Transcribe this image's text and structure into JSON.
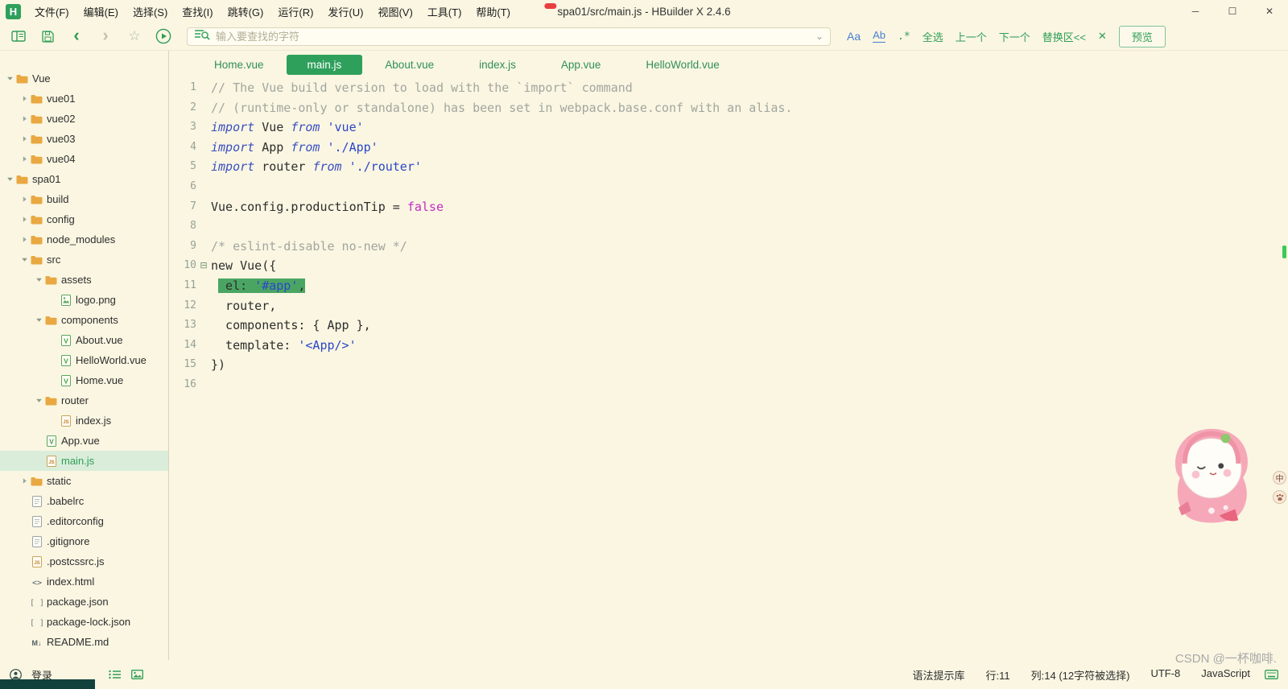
{
  "window": {
    "logo": "H",
    "title": "spa01/src/main.js - HBuilder X 2.4.6"
  },
  "menu": {
    "items": [
      "文件(F)",
      "编辑(E)",
      "选择(S)",
      "查找(I)",
      "跳转(G)",
      "运行(R)",
      "发行(U)",
      "视图(V)",
      "工具(T)",
      "帮助(T)"
    ]
  },
  "icons": {
    "minimize": "─",
    "maximize": "☐",
    "close": "✕",
    "back": "‹",
    "forward": "›",
    "star": "☆",
    "search_dropdown": "⌄",
    "match_case": "Aa",
    "whole_word": "Ab",
    "regex": ".*",
    "fold_collapse": "⊟",
    "ime": "中"
  },
  "colors": {
    "accent_green": "#2f9e57",
    "tab_active_bg": "#2fa05c",
    "selection_green": "#4aa563",
    "folder_yellow": "#e9a841",
    "badge_red": "#e84040",
    "scroll_marker": "#3ec957"
  },
  "toolbar": {
    "search_placeholder": "输入要查找的字符",
    "actions": [
      "全选",
      "上一个",
      "下一个",
      "替换区<<"
    ],
    "preview_label": "预览"
  },
  "sidebar": {
    "tree": [
      {
        "label": "Vue",
        "level": 0,
        "kind": "folder",
        "icon": "folder-icon",
        "state": "expanded"
      },
      {
        "label": "vue01",
        "level": 1,
        "kind": "folder",
        "icon": "folder-icon",
        "state": "collapsed"
      },
      {
        "label": "vue02",
        "level": 1,
        "kind": "folder",
        "icon": "folder-icon",
        "state": "collapsed"
      },
      {
        "label": "vue03",
        "level": 1,
        "kind": "folder",
        "icon": "folder-icon",
        "state": "collapsed"
      },
      {
        "label": "vue04",
        "level": 1,
        "kind": "folder",
        "icon": "folder-icon",
        "state": "collapsed"
      },
      {
        "label": "spa01",
        "level": 0,
        "kind": "folder",
        "icon": "folder-icon",
        "state": "expanded"
      },
      {
        "label": "build",
        "level": 1,
        "kind": "folder",
        "icon": "folder-icon",
        "state": "collapsed"
      },
      {
        "label": "config",
        "level": 1,
        "kind": "folder",
        "icon": "folder-icon",
        "state": "collapsed"
      },
      {
        "label": "node_modules",
        "level": 1,
        "kind": "folder",
        "icon": "folder-icon",
        "state": "collapsed"
      },
      {
        "label": "src",
        "level": 1,
        "kind": "folder",
        "icon": "folder-icon",
        "state": "expanded"
      },
      {
        "label": "assets",
        "level": 2,
        "kind": "folder",
        "icon": "folder-icon",
        "state": "expanded"
      },
      {
        "label": "logo.png",
        "level": 3,
        "kind": "file",
        "icon": "image-file-icon"
      },
      {
        "label": "components",
        "level": 2,
        "kind": "folder",
        "icon": "folder-icon",
        "state": "expanded"
      },
      {
        "label": "About.vue",
        "level": 3,
        "kind": "file",
        "icon": "vue-file-icon"
      },
      {
        "label": "HelloWorld.vue",
        "level": 3,
        "kind": "file",
        "icon": "vue-file-icon"
      },
      {
        "label": "Home.vue",
        "level": 3,
        "kind": "file",
        "icon": "vue-file-icon"
      },
      {
        "label": "router",
        "level": 2,
        "kind": "folder",
        "icon": "folder-icon",
        "state": "expanded"
      },
      {
        "label": "index.js",
        "level": 3,
        "kind": "file",
        "icon": "js-file-icon"
      },
      {
        "label": "App.vue",
        "level": 2,
        "kind": "file",
        "icon": "vue-file-icon"
      },
      {
        "label": "main.js",
        "level": 2,
        "kind": "file",
        "icon": "js-file-icon",
        "selected": true
      },
      {
        "label": "static",
        "level": 1,
        "kind": "folder",
        "icon": "folder-icon",
        "state": "collapsed"
      },
      {
        "label": ".babelrc",
        "level": 1,
        "kind": "file",
        "icon": "plain-file-icon"
      },
      {
        "label": ".editorconfig",
        "level": 1,
        "kind": "file",
        "icon": "plain-file-icon"
      },
      {
        "label": ".gitignore",
        "level": 1,
        "kind": "file",
        "icon": "plain-file-icon"
      },
      {
        "label": ".postcssrc.js",
        "level": 1,
        "kind": "file",
        "icon": "js-file-icon"
      },
      {
        "label": "index.html",
        "level": 1,
        "kind": "file",
        "icon": "html-file-icon"
      },
      {
        "label": "package.json",
        "level": 1,
        "kind": "file",
        "icon": "json-file-icon"
      },
      {
        "label": "package-lock.json",
        "level": 1,
        "kind": "file",
        "icon": "json-file-icon"
      },
      {
        "label": "README.md",
        "level": 1,
        "kind": "file",
        "icon": "md-file-icon"
      }
    ]
  },
  "editor": {
    "tabs": [
      {
        "label": "Home.vue"
      },
      {
        "label": "main.js",
        "active": true
      },
      {
        "label": "About.vue"
      },
      {
        "label": "index.js"
      },
      {
        "label": "App.vue"
      },
      {
        "label": "HelloWorld.vue"
      }
    ],
    "code": {
      "lines": [
        {
          "n": 1,
          "segs": [
            {
              "c": "com",
              "t": "// The Vue build version to load with the `import` command"
            }
          ]
        },
        {
          "n": 2,
          "segs": [
            {
              "c": "com",
              "t": "// (runtime-only or standalone) has been set in webpack.base.conf with an alias."
            }
          ]
        },
        {
          "n": 3,
          "segs": [
            {
              "c": "kw",
              "t": "import"
            },
            {
              "c": "plain",
              "t": " Vue "
            },
            {
              "c": "kw",
              "t": "from"
            },
            {
              "c": "plain",
              "t": " "
            },
            {
              "c": "str",
              "t": "'vue'"
            }
          ]
        },
        {
          "n": 4,
          "segs": [
            {
              "c": "kw",
              "t": "import"
            },
            {
              "c": "plain",
              "t": " App "
            },
            {
              "c": "kw",
              "t": "from"
            },
            {
              "c": "plain",
              "t": " "
            },
            {
              "c": "str",
              "t": "'./App'"
            }
          ]
        },
        {
          "n": 5,
          "segs": [
            {
              "c": "kw",
              "t": "import"
            },
            {
              "c": "plain",
              "t": " router "
            },
            {
              "c": "kw",
              "t": "from"
            },
            {
              "c": "plain",
              "t": " "
            },
            {
              "c": "str",
              "t": "'./router'"
            }
          ]
        },
        {
          "n": 6,
          "segs": []
        },
        {
          "n": 7,
          "segs": [
            {
              "c": "plain",
              "t": "Vue.config.productionTip = "
            },
            {
              "c": "bool",
              "t": "false"
            }
          ]
        },
        {
          "n": 8,
          "segs": []
        },
        {
          "n": 9,
          "segs": [
            {
              "c": "com",
              "t": "/* eslint-disable no-new */"
            }
          ]
        },
        {
          "n": 10,
          "fold": true,
          "segs": [
            {
              "c": "plain",
              "t": "new Vue({"
            }
          ]
        },
        {
          "n": 11,
          "segs": [
            {
              "c": "plain",
              "t": " "
            },
            {
              "c": "plain",
              "sel": true,
              "t": " el: "
            },
            {
              "c": "str",
              "sel": true,
              "t": "'#app'"
            },
            {
              "c": "plain",
              "sel": true,
              "t": ","
            }
          ]
        },
        {
          "n": 12,
          "segs": [
            {
              "c": "plain",
              "t": "  router,"
            }
          ]
        },
        {
          "n": 13,
          "segs": [
            {
              "c": "plain",
              "t": "  components: { App },"
            }
          ]
        },
        {
          "n": 14,
          "segs": [
            {
              "c": "plain",
              "t": "  template: "
            },
            {
              "c": "str",
              "t": "'<App/>'"
            }
          ]
        },
        {
          "n": 15,
          "segs": [
            {
              "c": "plain",
              "t": "})"
            }
          ]
        },
        {
          "n": 16,
          "segs": []
        }
      ]
    }
  },
  "statusbar": {
    "login": "登录",
    "items": [
      "语法提示库",
      "行:11",
      "列:14 (12字符被选择)",
      "UTF-8",
      "JavaScript"
    ]
  },
  "watermark": "CSDN @一杯咖啡."
}
